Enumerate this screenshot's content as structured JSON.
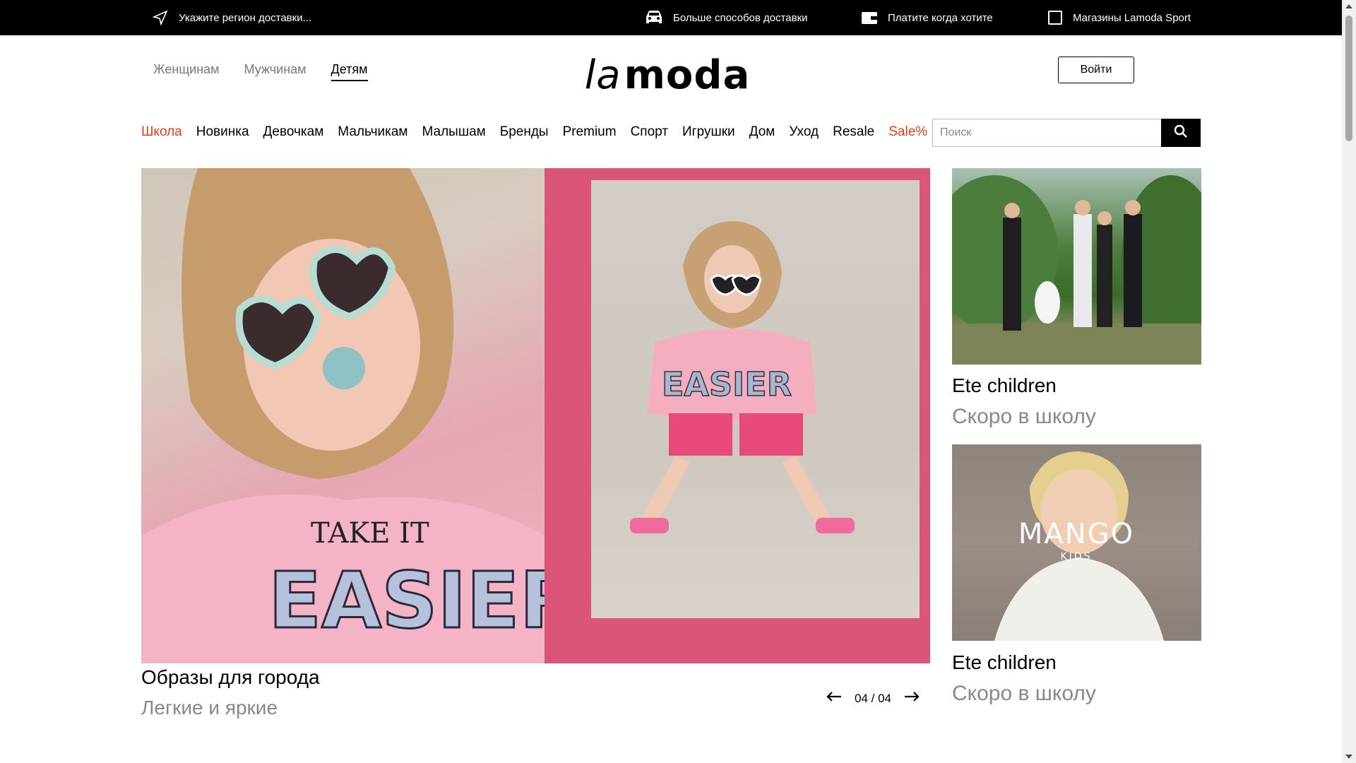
{
  "topbar": {
    "region": "Укажите регион доставки...",
    "delivery": "Больше способов доставки",
    "pay": "Платите когда хотите",
    "stores": "Магазины Lamoda Sport"
  },
  "header": {
    "gender_nav": [
      "Женщинам",
      "Мужчинам",
      "Детям"
    ],
    "logo": "lamoda",
    "login": "Войти"
  },
  "categories": [
    "Школа",
    "Новинка",
    "Девочкам",
    "Мальчикам",
    "Малышам",
    "Бренды",
    "Premium",
    "Спорт",
    "Игрушки",
    "Дом",
    "Уход",
    "Resale",
    "Sale%"
  ],
  "search": {
    "placeholder": "Поиск"
  },
  "banner": {
    "title": "Образы для города",
    "subtitle": "Легкие и яркие",
    "pager": "04 / 04",
    "shirt_top": "TAKE IT",
    "shirt_text": "EASIER"
  },
  "cards": [
    {
      "title": "Ete children",
      "subtitle": "Скоро в школу"
    },
    {
      "title": "Ete children",
      "subtitle": "Скоро в школу",
      "brand": "MANGO",
      "brand_sub": "KIDS"
    }
  ],
  "colors": {
    "accent_red": "#e33b15",
    "banner_pink": "#db557a"
  }
}
